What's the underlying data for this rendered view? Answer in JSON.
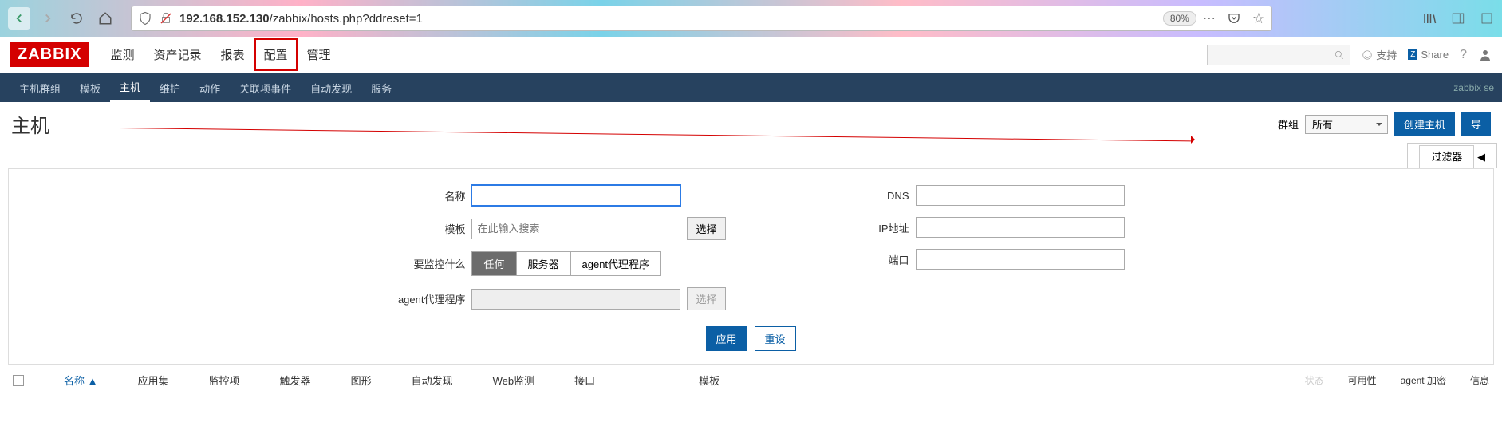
{
  "browser": {
    "url_prefix": "192.168.152.130",
    "url_path": "/zabbix/hosts.php?ddreset=1",
    "zoom": "80%"
  },
  "header": {
    "logo": "ZABBIX",
    "nav": [
      "监测",
      "资产记录",
      "报表",
      "配置",
      "管理"
    ],
    "support": "支持",
    "share": "Share"
  },
  "subnav": {
    "items": [
      "主机群组",
      "模板",
      "主机",
      "维护",
      "动作",
      "关联项事件",
      "自动发现",
      "服务"
    ],
    "server": "zabbix se"
  },
  "page": {
    "title": "主机",
    "group_label": "群组",
    "group_value": "所有",
    "create_btn": "创建主机",
    "import_btn": "导",
    "filter_tab": "过滤器"
  },
  "filter": {
    "name_label": "名称",
    "template_label": "模板",
    "template_placeholder": "在此输入搜索",
    "select_btn": "选择",
    "monitor_label": "要监控什么",
    "monitor_opts": [
      "任何",
      "服务器",
      "agent代理程序"
    ],
    "proxy_label": "agent代理程序",
    "dns_label": "DNS",
    "ip_label": "IP地址",
    "port_label": "端口",
    "apply": "应用",
    "reset": "重设"
  },
  "table": {
    "cols": [
      "名称",
      "应用集",
      "监控项",
      "触发器",
      "图形",
      "自动发现",
      "Web监测",
      "接口",
      "模板",
      "状态",
      "可用性",
      "agent 加密",
      "信息"
    ],
    "sort_indicator": "▲"
  }
}
